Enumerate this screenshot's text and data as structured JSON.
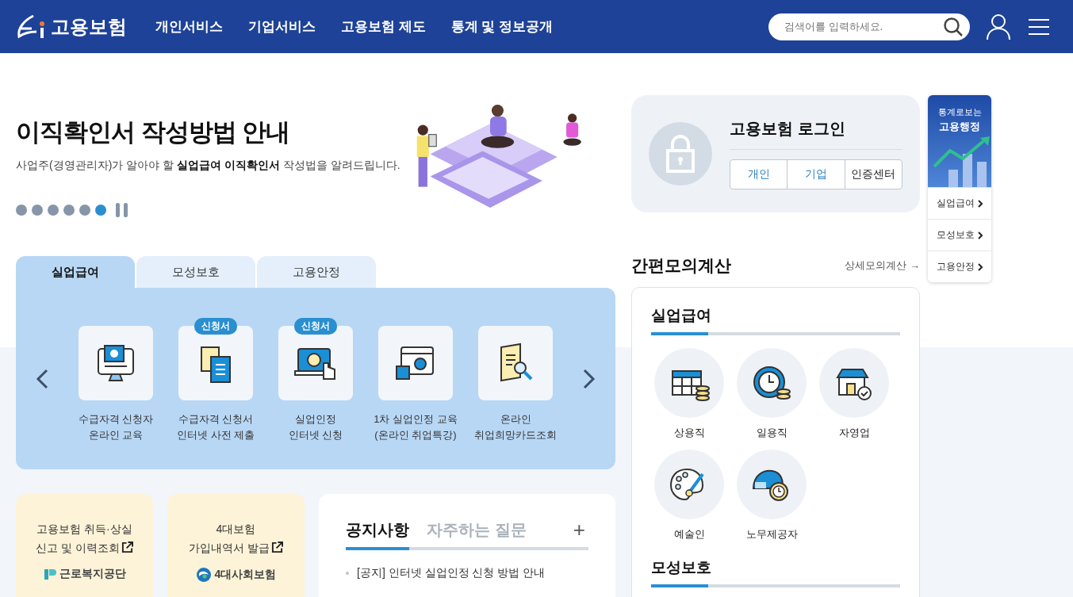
{
  "header": {
    "logo": "고용보험",
    "nav": [
      "개인서비스",
      "기업서비스",
      "고용보험 제도",
      "통계 및 정보공개"
    ],
    "search": {
      "placeholder": "검색어를 입력하세요."
    }
  },
  "hero": {
    "title": "이직확인서 작성방법 안내",
    "subtitle": "사업주(경영관리자)가 알아야 할 **실업급여 이직확인서** 작성법을 알려드립니다.",
    "dots": [
      {
        "selected": false
      },
      {
        "selected": false
      },
      {
        "selected": false
      },
      {
        "selected": false
      },
      {
        "selected": false
      },
      {
        "selected": true
      }
    ]
  },
  "tabs": [
    {
      "label": "실업급여",
      "selected": true
    },
    {
      "label": "모성보호",
      "selected": false
    },
    {
      "label": "고용안정",
      "selected": false
    }
  ],
  "services": [
    {
      "label": "수급자격 신청자\n온라인 교육"
    },
    {
      "label": "수급자격 신청서\n인터넷 사전 제출",
      "badge": "신청서"
    },
    {
      "label": "실업인정\n인터넷 신청",
      "badge": "신청서"
    },
    {
      "label": "1차 실업인정 교육\n(온라인 취업특강)"
    },
    {
      "label": "온라인\n취업희망카드조회"
    }
  ],
  "quick_cards": [
    {
      "text": "고용보험 취득·상실\n신고 및 이력조회",
      "org": "근로복지공단"
    },
    {
      "text": "4대보험\n가입내역서 발급",
      "org": "4대사회보험"
    }
  ],
  "notice": {
    "tabs": [
      {
        "label": "공지사항",
        "selected": true
      },
      {
        "label": "자주하는 질문",
        "selected": false
      }
    ],
    "more": "+",
    "items": [
      "[공지] 인터넷 실업인정 신청 방법 안내"
    ]
  },
  "login": {
    "title": "고용보험 로그인",
    "buttons": [
      {
        "label": "개인",
        "kind": "member"
      },
      {
        "label": "기업",
        "kind": "member"
      },
      {
        "label": "인증센터",
        "kind": "plain"
      }
    ]
  },
  "calc": {
    "title": "간편모의계산",
    "link": "상세모의계산 →",
    "sections": [
      {
        "title": "실업급여",
        "items": [
          "상용직",
          "일용직",
          "자영업",
          "예술인",
          "노무제공자"
        ]
      },
      {
        "title": "모성보호"
      }
    ]
  },
  "side": {
    "title_small": "통계로보는",
    "title": "고용행정",
    "links": [
      "실업급여",
      "모성보호",
      "고용안정"
    ]
  }
}
